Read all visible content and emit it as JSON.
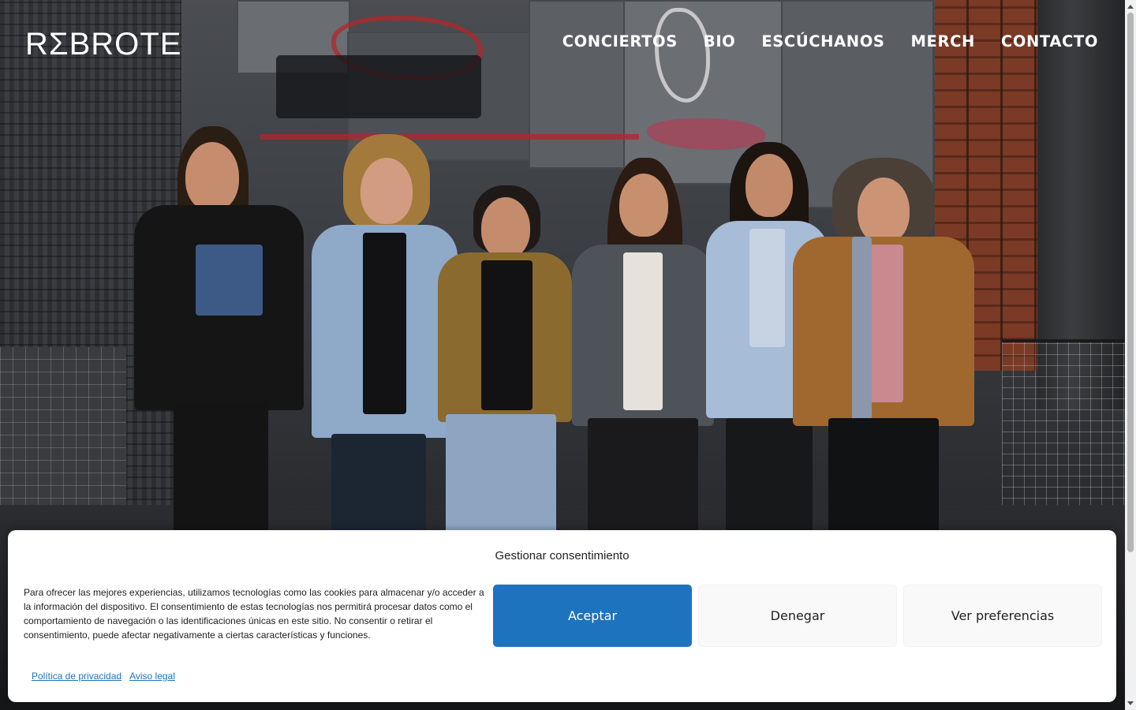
{
  "site": {
    "logo_text": "RΣBROTE"
  },
  "nav": {
    "items": [
      {
        "label": "CONCIERTOS"
      },
      {
        "label": "BIO"
      },
      {
        "label": "ESCÚCHANOS"
      },
      {
        "label": "MERCH"
      },
      {
        "label": "CONTACTO"
      }
    ]
  },
  "cookie_banner": {
    "title": "Gestionar consentimiento",
    "text": "Para ofrecer las mejores experiencias, utilizamos tecnologías como las cookies para almacenar y/o acceder a la información del dispositivo. El consentimiento de estas tecnologías nos permitirá procesar datos como el comportamiento de navegación o las identificaciones únicas en este sitio. No consentir o retirar el consentimiento, puede afectar negativamente a ciertas características y funciones.",
    "accept_label": "Aceptar",
    "deny_label": "Denegar",
    "preferences_label": "Ver preferencias",
    "privacy_link": "Política de privacidad",
    "legal_link": "Aviso legal"
  },
  "colors": {
    "accent": "#1e73be",
    "header_text": "#ffffff"
  }
}
